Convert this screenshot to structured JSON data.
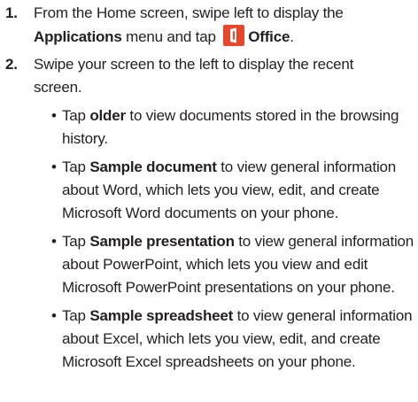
{
  "steps": [
    {
      "number": "1.",
      "lines": [
        {
          "before": "From the Home screen, swipe left to display the"
        },
        {
          "bold1": "Applications",
          "mid": " menu and tap ",
          "icon": "office-icon",
          "bold2": "Office",
          "after": "."
        }
      ]
    },
    {
      "number": "2.",
      "lines": [
        "Swipe your screen to the left to display the recent",
        "screen."
      ]
    }
  ],
  "bullets": [
    {
      "marker": "•",
      "bold": "older",
      "first_rest": " to view documents stored in the browsing",
      "lead": "Tap ",
      "more_lines": [
        "history."
      ]
    },
    {
      "marker": "•",
      "lead": "Tap ",
      "bold": "Sample document",
      "first_rest": " to view general information",
      "more_lines": [
        "about Word, which lets you view, edit, and create",
        "Microsoft Word documents on your phone."
      ]
    },
    {
      "marker": "•",
      "lead": "Tap ",
      "bold": "Sample presentation",
      "first_rest": " to view general information",
      "more_lines": [
        "about PowerPoint, which lets you view and edit",
        "Microsoft PowerPoint presentations on your phone."
      ]
    },
    {
      "marker": "•",
      "lead": "Tap ",
      "bold": "Sample spreadsheet",
      "first_rest": " to view general information",
      "more_lines": [
        "about Excel, which lets you view, edit, and create",
        "Microsoft Excel spreadsheets on your phone."
      ]
    }
  ],
  "colors": {
    "text": "#231f20",
    "office_icon": "#e8462a"
  }
}
